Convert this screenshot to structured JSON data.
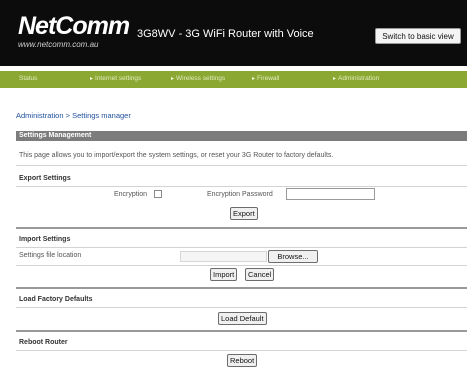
{
  "header": {
    "logo": "NetComm",
    "logo_url": "www.netcomm.com.au",
    "product_title": "3G8WV - 3G WiFi Router with Voice",
    "switch_button": "Switch to basic view"
  },
  "nav": {
    "items": [
      "Status",
      "Internet settings",
      "Wireless settings",
      "Firewall",
      "Administration"
    ]
  },
  "breadcrumb": "Administration > Settings manager",
  "panel": {
    "title": "Settings Management",
    "description": "This page allows you to import/export the system settings, or reset your 3G Router to factory defaults."
  },
  "export": {
    "heading": "Export Settings",
    "encryption_label": "Encryption",
    "password_label": "Encryption Password",
    "password_value": "",
    "button": "Export"
  },
  "import": {
    "heading": "Import Settings",
    "file_label": "Settings file location",
    "browse_button": "Browse...",
    "import_button": "Import",
    "cancel_button": "Cancel"
  },
  "factory": {
    "heading": "Load Factory Defaults",
    "button": "Load Default"
  },
  "reboot": {
    "heading": "Reboot Router",
    "button": "Reboot"
  }
}
